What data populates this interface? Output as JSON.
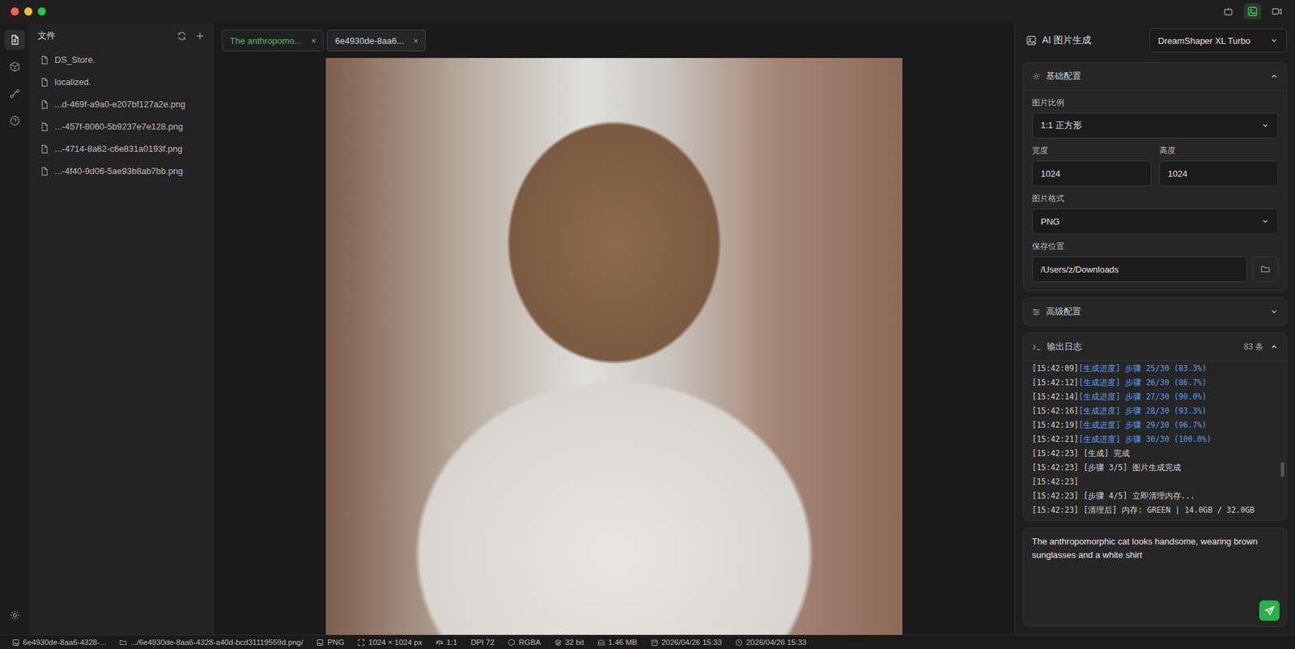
{
  "window": {
    "title_bar_icons": [
      {
        "kind": "robot",
        "selected": false
      },
      {
        "kind": "image",
        "selected": true
      },
      {
        "kind": "video",
        "selected": false
      }
    ]
  },
  "rail": {
    "items": [
      {
        "kind": "files",
        "selected": true
      },
      {
        "kind": "models",
        "selected": false
      },
      {
        "kind": "workflow",
        "selected": false
      },
      {
        "kind": "help",
        "selected": false
      }
    ]
  },
  "file_panel": {
    "title": "文件",
    "files": [
      {
        "name": "DS_Store."
      },
      {
        "name": "localized."
      },
      {
        "name": "...d-469f-a9a0-e207bf127a2e.png"
      },
      {
        "name": "...-457f-8060-5b9237e7e128.png"
      },
      {
        "name": "...-4714-8a62-c6e831a0193f.png"
      },
      {
        "name": "...-4f40-9d06-5ae93b8ab7bb.png"
      }
    ]
  },
  "tabs": [
    {
      "label": "The anthropomo...",
      "selected": false,
      "color": "#4cc25f",
      "close": "×"
    },
    {
      "label": "6e4930de-8aa6...",
      "selected": true,
      "color": "#d4d4d4",
      "close": "×"
    }
  ],
  "panel": {
    "title": "AI 图片生成",
    "model": "DreamShaper XL Turbo",
    "basic": {
      "title": "基础配置",
      "expanded": true,
      "ratio": {
        "label": "图片比例",
        "value": "1:1 正方形"
      },
      "width": {
        "label": "宽度",
        "value": "1024"
      },
      "height": {
        "label": "高度",
        "value": "1024"
      },
      "format": {
        "label": "图片格式",
        "value": "PNG"
      },
      "save": {
        "label": "保存位置",
        "value": "/Users/z/Downloads"
      }
    },
    "advanced": {
      "title": "高级配置",
      "expanded": false
    },
    "log": {
      "title": "输出日志",
      "count": "83 条",
      "expanded": true,
      "lines": [
        {
          "time": "[15:42:09]",
          "text": "[生成进度] 步骤 25/30 (83.3%)",
          "kind": "progress"
        },
        {
          "time": "[15:42:12]",
          "text": "[生成进度] 步骤 26/30 (86.7%)",
          "kind": "progress"
        },
        {
          "time": "[15:42:14]",
          "text": "[生成进度] 步骤 27/30 (90.0%)",
          "kind": "progress"
        },
        {
          "time": "[15:42:16]",
          "text": "[生成进度] 步骤 28/30 (93.3%)",
          "kind": "progress"
        },
        {
          "time": "[15:42:19]",
          "text": "[生成进度] 步骤 29/30 (96.7%)",
          "kind": "progress"
        },
        {
          "time": "[15:42:21]",
          "text": "[生成进度] 步骤 30/30 (100.0%)",
          "kind": "progress"
        },
        {
          "time": "[15:42:23]",
          "text": " [生成] 完成",
          "kind": "info"
        },
        {
          "time": "[15:42:23]",
          "text": " [步骤 3/5] 图片生成完成",
          "kind": "info"
        },
        {
          "time": "[15:42:23]",
          "text": "",
          "kind": "info"
        },
        {
          "time": "[15:42:23]",
          "text": " [步骤 4/5] 立即清理内存...",
          "kind": "info"
        },
        {
          "time": "[15:42:23]",
          "text": " [清理后] 内存: GREEN | 14.0GB / 32.0GB",
          "kind": "info"
        }
      ]
    },
    "prompt": {
      "text": "The anthropomorphic cat looks handsome, wearing brown sunglasses and a white shirt"
    }
  },
  "status_bar": [
    {
      "kind": "file",
      "text": "6e4930de-8aa6-4328-..."
    },
    {
      "kind": "folder",
      "text": ".../6e4930de-8aa6-4328-a40d-bcd31119559d.png/"
    },
    {
      "kind": "format",
      "text": "PNG"
    },
    {
      "kind": "size",
      "text": "1024 × 1024 px"
    },
    {
      "kind": "ratio",
      "text": "1:1"
    },
    {
      "kind": "dpi",
      "text": "DPI 72"
    },
    {
      "kind": "color",
      "text": "RGBA"
    },
    {
      "kind": "depth",
      "text": "32 bit"
    },
    {
      "kind": "disk",
      "text": "1.46 MB"
    },
    {
      "kind": "created",
      "text": "2026/04/26 15:33"
    },
    {
      "kind": "modified",
      "text": "2026/04/26 15:33"
    }
  ]
}
